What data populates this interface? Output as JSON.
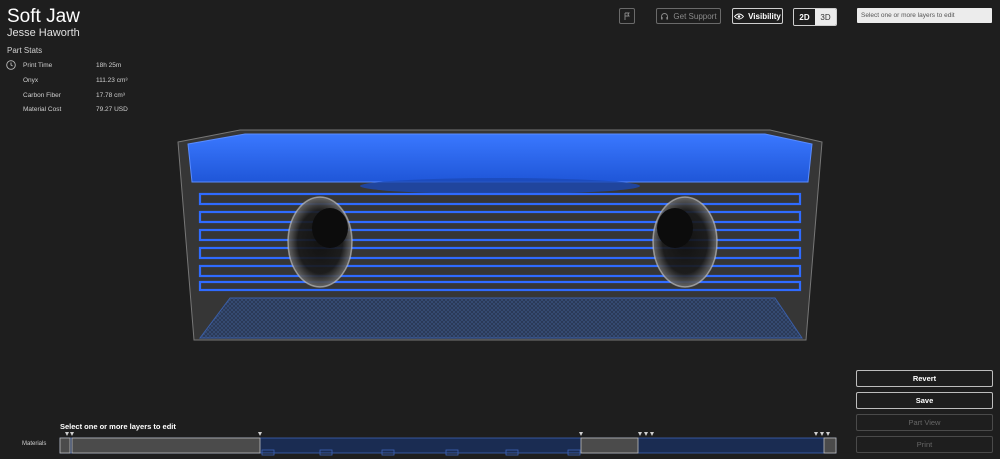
{
  "part": {
    "title": "Soft Jaw",
    "author": "Jesse Haworth"
  },
  "stats": {
    "heading": "Part Stats",
    "rows": [
      {
        "label": "Print Time",
        "value": "18h 25m"
      },
      {
        "label": "Onyx",
        "value": "111.23 cm³"
      },
      {
        "label": "Carbon Fiber",
        "value": "17.78 cm³"
      },
      {
        "label": "Material Cost",
        "value": "79.27 USD"
      }
    ]
  },
  "toolbar": {
    "support_label": "Get Support",
    "visibility_label": "Visibility",
    "view_2d": "2D",
    "view_3d": "3D",
    "layer_select_placeholder": "Select one or more layers to edit"
  },
  "actions": {
    "revert": "Revert",
    "save": "Save",
    "part_view": "Part View",
    "print": "Print"
  },
  "timeline": {
    "prompt": "Select one or more layers to edit",
    "row_label": "Materials"
  },
  "colors": {
    "background": "#1e1e1e",
    "fiber_blue": "#2f6bff",
    "part_gray": "#5a5a5a"
  }
}
